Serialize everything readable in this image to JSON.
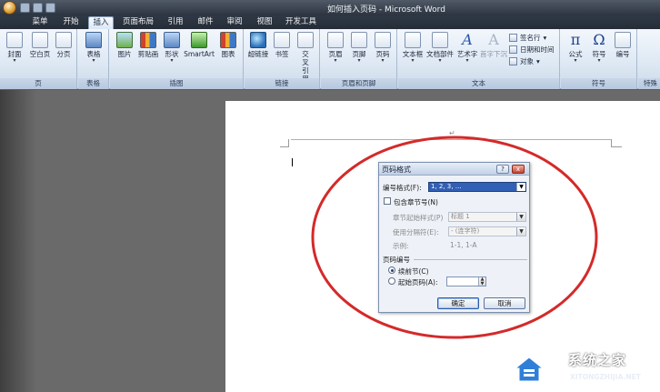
{
  "window": {
    "title": "如何插入页码 - Microsoft Word"
  },
  "tabs": [
    {
      "label": "菜单"
    },
    {
      "label": "开始"
    },
    {
      "label": "插入"
    },
    {
      "label": "页面布局"
    },
    {
      "label": "引用"
    },
    {
      "label": "邮件"
    },
    {
      "label": "审阅"
    },
    {
      "label": "视图"
    },
    {
      "label": "开发工具"
    }
  ],
  "active_tab": "插入",
  "ribbon": {
    "groups": {
      "pages": {
        "title": "页",
        "buttons": [
          "封面",
          "空白页",
          "分页"
        ]
      },
      "tables": {
        "title": "表格",
        "buttons": [
          "表格"
        ]
      },
      "illustrations": {
        "title": "插图",
        "buttons": [
          "图片",
          "剪贴画",
          "形状",
          "SmartArt",
          "图表"
        ]
      },
      "links": {
        "title": "链接",
        "buttons": [
          "超链接",
          "书签",
          "交叉引用"
        ]
      },
      "header_footer": {
        "title": "页眉和页脚",
        "buttons": [
          "页眉",
          "页脚",
          "页码"
        ]
      },
      "text": {
        "title": "文本",
        "buttons": [
          "文本框",
          "文档部件",
          "艺术字",
          "首字下沉"
        ],
        "small": [
          "签名行",
          "日期和时间",
          "对象"
        ]
      },
      "symbols": {
        "title": "符号",
        "buttons": [
          "公式",
          "符号",
          "编号"
        ]
      },
      "special": {
        "title": "特殊"
      }
    }
  },
  "dialog": {
    "title": "页码格式",
    "number_format_label": "编号格式(F):",
    "number_format_value": "1, 2, 3, …",
    "include_chapter_label": "包含章节号(N)",
    "chapter_style_label": "章节起始样式(P)",
    "chapter_style_value": "标题 1",
    "separator_label": "使用分隔符(E):",
    "separator_value": "-  (连字符)",
    "example_label": "示例:",
    "example_value": "1-1, 1-A",
    "numbering_section": "页码编号",
    "continue_label": "续前节(C)",
    "start_at_label": "起始页码(A):",
    "start_at_value": "",
    "ok_label": "确定",
    "cancel_label": "取消",
    "help_glyph": "?",
    "close_glyph": "x"
  },
  "page": {
    "para_mark": "↵"
  },
  "watermark": {
    "name": "系统之家",
    "url": "XITONGZHIJIA.NET"
  },
  "colors": {
    "annotation": "#d42a2a",
    "title_bar": "#2c3440",
    "ribbon": "#dde8f4",
    "accent": "#3160b4"
  }
}
